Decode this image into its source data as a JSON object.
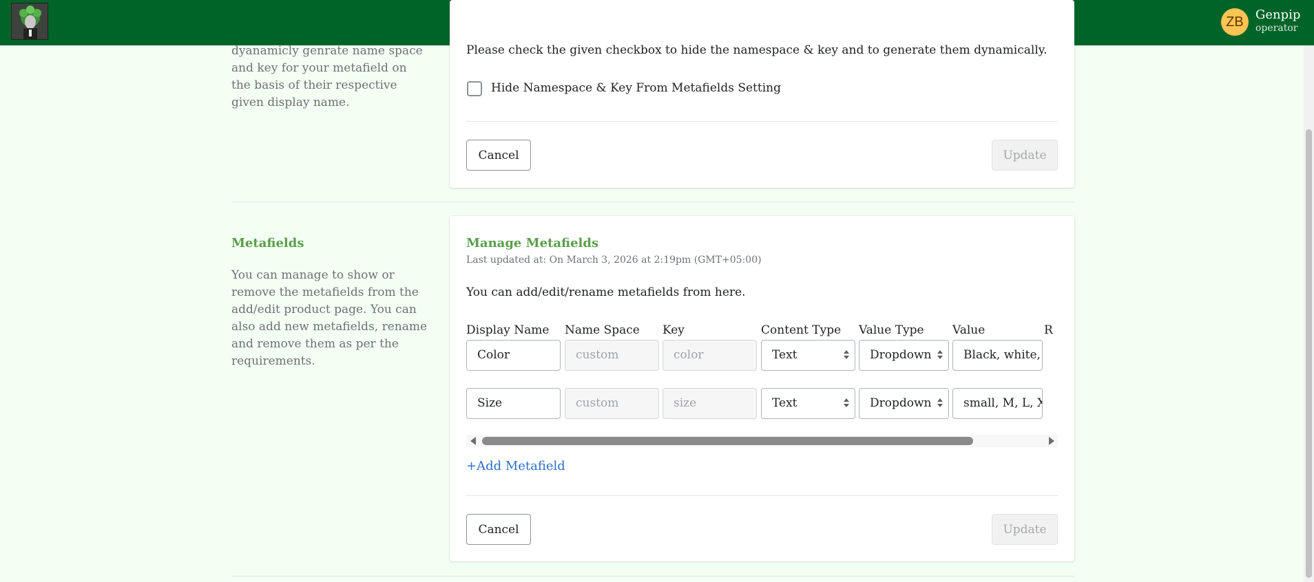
{
  "header": {
    "user_initials": "ZB",
    "user_name": "Genpip",
    "user_role": "operator",
    "bg_color": "#006428",
    "avatar_color": "#ffc453"
  },
  "namespace_section": {
    "description": "dyanamicly genrate name space and key for your metafield on the basis of their respective given display name.",
    "instruction": "Please check the given checkbox to hide the namespace & key and to generate them dynamically.",
    "checkbox_label": "Hide Namespace & Key From Metafields Setting",
    "checkbox_checked": false,
    "cancel_label": "Cancel",
    "update_label": "Update"
  },
  "metafields_section": {
    "title": "Metafields",
    "description": "You can manage to show or remove the metafields from the add/edit product page. You can also add new metafields, rename and remove them as per the requirements.",
    "card_title": "Manage Metafields",
    "last_updated": "Last updated at: On March 3, 2026 at 2:19pm (GMT+05:00)",
    "intro": "You can add/edit/rename metafields from here.",
    "columns": [
      "Display Name",
      "Name Space",
      "Key",
      "Content Type",
      "Value Type",
      "Value",
      "R"
    ],
    "rows": [
      {
        "display_name": "Color",
        "namespace_placeholder": "custom",
        "key_placeholder": "color",
        "content_type": "Text",
        "value_type": "Dropdown",
        "value": "Black, white,"
      },
      {
        "display_name": "Size",
        "namespace_placeholder": "custom",
        "key_placeholder": "size",
        "content_type": "Text",
        "value_type": "Dropdown",
        "value": "small, M, L, X"
      }
    ],
    "add_link": "+Add Metafield",
    "cancel_label": "Cancel",
    "update_label": "Update",
    "title_color": "#5a9e4a",
    "link_color": "#2c6ecb"
  }
}
